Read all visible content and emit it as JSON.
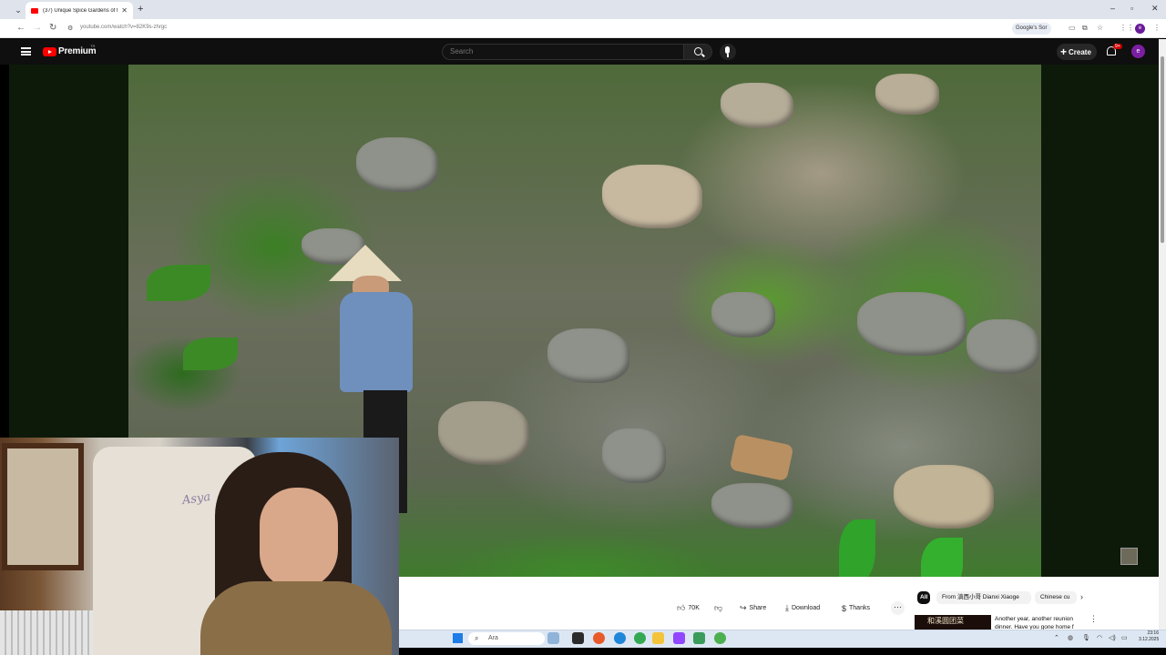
{
  "browser": {
    "tab_title": "(37) Unique Spice Gardens of t",
    "url": "youtube.com/watch?v=82K9s-zhrgc",
    "google_search_chip": "Google's Sor",
    "profile_initial": "e"
  },
  "youtube": {
    "brand": "Premium",
    "country_code": "TR",
    "search_placeholder": "Search",
    "create_label": "Create",
    "notification_count": "9+",
    "avatar_initial": "e"
  },
  "webcam_overlay": {
    "chair_text": "Asya"
  },
  "actions": {
    "like_count": "70K",
    "share_label": "Share",
    "download_label": "Download",
    "thanks_label": "Thanks",
    "more_label": "···"
  },
  "chips": [
    {
      "label": "All",
      "active": true
    },
    {
      "label": "From 滇西小哥 Dianxi Xiaoge",
      "active": false
    },
    {
      "label": "Chinese cu",
      "active": false
    }
  ],
  "recommended": {
    "thumb_text": "和溪圆团菜",
    "title": "Another year, another reunion dinner. Have you gone home f"
  },
  "taskbar": {
    "search_placeholder": "Ara",
    "time": "23:16",
    "date": "3.12.2025"
  },
  "icons": [
    "hamburger-icon",
    "youtube-logo-icon",
    "search-icon",
    "mic-icon",
    "bell-icon",
    "like-icon",
    "dislike-icon",
    "share-icon",
    "download-icon",
    "thanks-icon",
    "windows-start-icon"
  ]
}
